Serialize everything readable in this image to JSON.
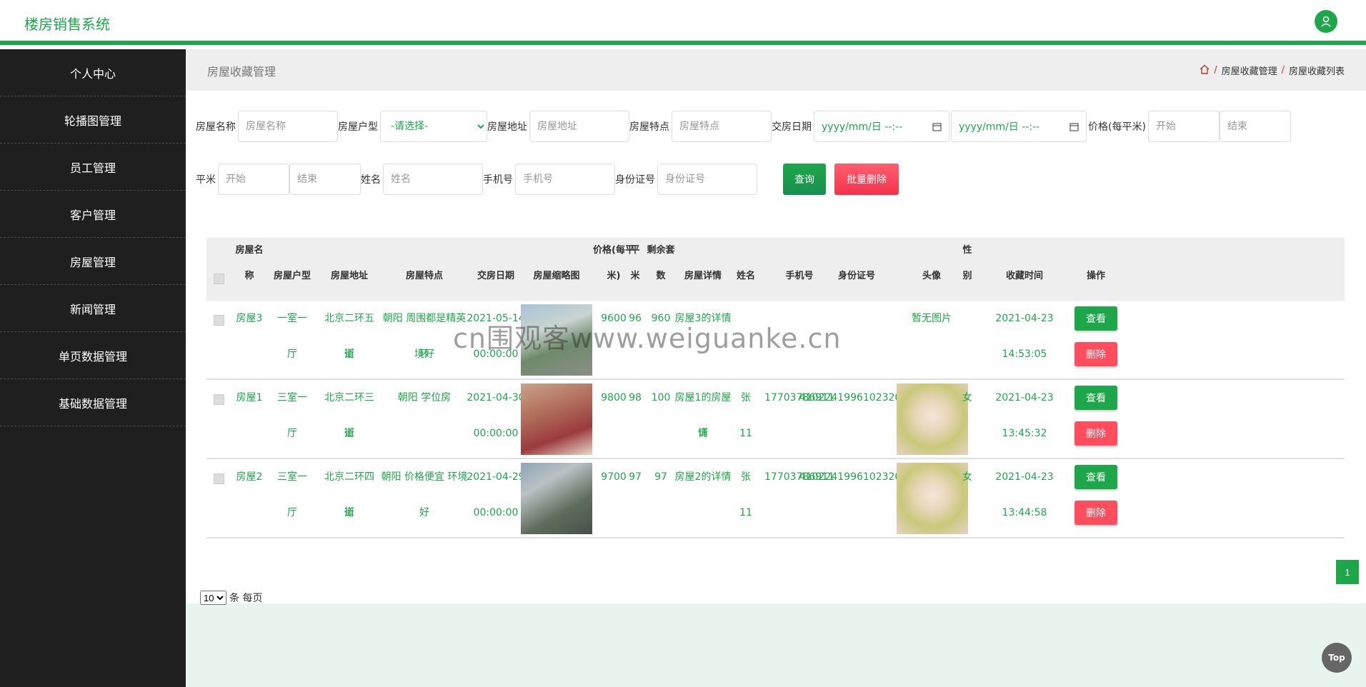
{
  "header": {
    "title": "楼房销售系统",
    "user_icon": "user-icon"
  },
  "sidebar": {
    "items": [
      {
        "label": "个人中心"
      },
      {
        "label": "轮播图管理"
      },
      {
        "label": "员工管理"
      },
      {
        "label": "客户管理"
      },
      {
        "label": "房屋管理"
      },
      {
        "label": "新闻管理"
      },
      {
        "label": "单页数据管理"
      },
      {
        "label": "基础数据管理"
      }
    ]
  },
  "page": {
    "title": "房屋收藏管理",
    "breadcrumb": [
      "房屋收藏管理",
      "房屋收藏列表"
    ]
  },
  "search": {
    "name_label": "房屋名称",
    "name_placeholder": "房屋名称",
    "type_label": "房屋户型",
    "type_value": "-请选择-",
    "addr_label": "房屋地址",
    "addr_placeholder": "房屋地址",
    "feature_label": "房屋特点",
    "feature_placeholder": "房屋特点",
    "date_label": "交房日期",
    "date_placeholder": "yyyy/mm/日 --:--",
    "price_label": "价格(每平米)",
    "start_placeholder": "开始",
    "end_placeholder": "结束",
    "area_label": "平米",
    "person_label": "姓名",
    "person_placeholder": "姓名",
    "phone_label": "手机号",
    "phone_placeholder": "手机号",
    "id_label": "身份证号",
    "id_placeholder": "身份证号",
    "query_btn": "查询",
    "batch_delete_btn": "批量删除"
  },
  "table": {
    "headers": {
      "name_1": "房屋名",
      "name_2": "称",
      "type": "房屋户型",
      "address": "房屋地址",
      "feature": "房屋特点",
      "date": "交房日期",
      "thumb": "房屋缩略图",
      "price_1": "价格(每平",
      "price_2": "米)",
      "area_1": "平",
      "area_2": "米",
      "remain_1": "剩余套",
      "remain_2": "数",
      "detail": "房屋详情",
      "person": "姓名",
      "phone": "手机号",
      "idcard": "身份证号",
      "avatar": "头像",
      "gender_1": "性",
      "gender_2": "别",
      "fav_time": "收藏时间",
      "action": "操作"
    },
    "rows": [
      {
        "name": "房屋3",
        "type_1": "一室一",
        "type_2": "厅",
        "addr_1": "北京二环五街",
        "addr_2": "道",
        "feature_1": "朝阳 周围都是精英 环",
        "feature_2": "境好",
        "date_1": "2021-05-14",
        "date_2": "00:00:00",
        "price": "9600",
        "area": "96",
        "remain": "960",
        "detail_1": "房屋3的详情",
        "detail_2": "",
        "person_1": "",
        "person_2": "",
        "phone": "",
        "idcard": "",
        "avatar_text": "暂无图片",
        "gender": "",
        "time_1": "2021-04-23",
        "time_2": "14:53:05",
        "view": "查看",
        "delete": "删除"
      },
      {
        "name": "房屋1",
        "type_1": "三室一",
        "type_2": "厅",
        "addr_1": "北京二环三街",
        "addr_2": "道",
        "feature_1": "朝阳 学位房",
        "feature_2": "",
        "date_1": "2021-04-30",
        "date_2": "00:00:00",
        "price": "9800",
        "area": "98",
        "remain": "100",
        "detail_1": "房屋1的房屋详",
        "detail_2": "情",
        "person_1": "张",
        "person_2": "11",
        "phone": "17703786911",
        "idcard": "410224199610232011",
        "avatar_text": "",
        "gender": "女",
        "time_1": "2021-04-23",
        "time_2": "13:45:32",
        "view": "查看",
        "delete": "删除"
      },
      {
        "name": "房屋2",
        "type_1": "三室一",
        "type_2": "厅",
        "addr_1": "北京二环四街",
        "addr_2": "道",
        "feature_1": "朝阳 价格便宜 环境好",
        "feature_2": "",
        "date_1": "2021-04-29",
        "date_2": "00:00:00",
        "price": "9700",
        "area": "97",
        "remain": "97",
        "detail_1": "房屋2的详情",
        "detail_2": "",
        "person_1": "张",
        "person_2": "11",
        "phone": "17703786911",
        "idcard": "410224199610232011",
        "avatar_text": "",
        "gender": "女",
        "time_1": "2021-04-23",
        "time_2": "13:44:58",
        "view": "查看",
        "delete": "删除"
      }
    ]
  },
  "pagination": {
    "page_size": "10",
    "per_page_label": "条 每页",
    "current_page": "1"
  },
  "watermark": "cn围观客www.weiguanke.cn",
  "top_button": "Top",
  "colors": {
    "accent": "#1ea64a",
    "sidebar": "#1f1f1f",
    "danger": "#ff4d5e"
  }
}
